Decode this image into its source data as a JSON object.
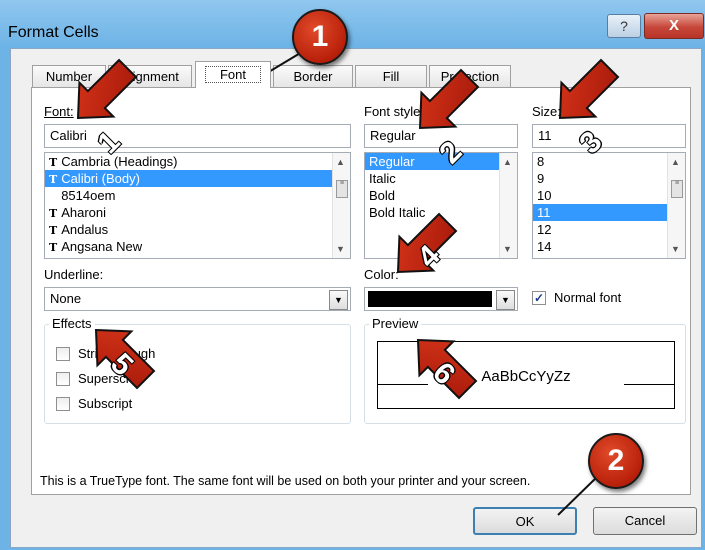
{
  "window": {
    "title": "Format Cells",
    "help_label": "?",
    "close_label": "X"
  },
  "tabs": [
    {
      "label": "Number"
    },
    {
      "label": "Alignment"
    },
    {
      "label": "Font",
      "active": true
    },
    {
      "label": "Border"
    },
    {
      "label": "Fill"
    },
    {
      "label": "Protection"
    }
  ],
  "font": {
    "label": "Font:",
    "value": "Calibri",
    "list": [
      {
        "label": "Cambria (Headings)",
        "truetype": true
      },
      {
        "label": "Calibri (Body)",
        "truetype": true,
        "selected": true
      },
      {
        "label": "8514oem",
        "truetype": false
      },
      {
        "label": "Aharoni",
        "truetype": true
      },
      {
        "label": "Andalus",
        "truetype": true
      },
      {
        "label": "Angsana New",
        "truetype": true
      }
    ]
  },
  "font_style": {
    "label": "Font style:",
    "value": "Regular",
    "list": [
      {
        "label": "Regular",
        "selected": true
      },
      {
        "label": "Italic"
      },
      {
        "label": "Bold"
      },
      {
        "label": "Bold Italic"
      }
    ]
  },
  "size": {
    "label": "Size:",
    "value": "11",
    "list": [
      {
        "label": "8"
      },
      {
        "label": "9"
      },
      {
        "label": "10"
      },
      {
        "label": "11",
        "selected": true
      },
      {
        "label": "12"
      },
      {
        "label": "14"
      }
    ]
  },
  "underline": {
    "label": "Underline:",
    "value": "None"
  },
  "color": {
    "label": "Color:",
    "swatch": "#000000"
  },
  "normal_font": {
    "label": "Normal font",
    "checked": true
  },
  "effects": {
    "title": "Effects",
    "items": [
      {
        "label": "Strikethrough",
        "checked": false
      },
      {
        "label": "Superscript",
        "checked": false
      },
      {
        "label": "Subscript",
        "checked": false
      }
    ]
  },
  "preview": {
    "title": "Preview",
    "sample": "AaBbCcYyZz"
  },
  "info_text": "This is a TrueType font.  The same font will be used on both your printer and your screen.",
  "buttons": {
    "ok": "OK",
    "cancel": "Cancel"
  },
  "callouts": [
    "1",
    "2"
  ],
  "arrows": [
    "1",
    "2",
    "3",
    "4",
    "5",
    "6"
  ],
  "colors": {
    "title_bar": "#6db3e6",
    "selection": "#3399ff",
    "callout": "#c0280e",
    "close_button": "#c7463a"
  }
}
